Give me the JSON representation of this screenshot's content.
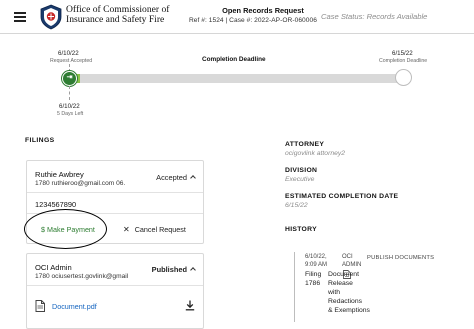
{
  "header": {
    "agency_line1": "Office of Commissioner of",
    "agency_line2": "Insurance and Safety Fire",
    "title": "Open Records Request",
    "ref_line": "Ref #: 1524 | Case #: 2022-AP-OR-060006",
    "case_status": "Case Status: Records Available"
  },
  "timeline": {
    "start_date": "6/10/22",
    "start_label": "Request Accepted",
    "current_date": "6/10/22",
    "current_label": "5 Days Left",
    "deadline_label": "Completion Deadline",
    "end_date": "6/15/22",
    "end_label": "Completion Deadline",
    "progress": 0.02
  },
  "filings": {
    "heading": "FILINGS",
    "card1": {
      "name": "Ruthie Awbrey",
      "sub": "1780   ruthieroo@gmail.com   06.",
      "status": "Accepted",
      "phone": "1234567890",
      "pay_label": "$ Make Payment",
      "cancel_label": "Cancel Request"
    },
    "card2": {
      "name": "OCI Admin",
      "sub": "1780   ociusertest.govlink@gmail",
      "status": "Published",
      "document": "Document.pdf"
    }
  },
  "details": {
    "attorney_label": "ATTORNEY",
    "attorney_value": "ocigovlink attorney2",
    "division_label": "DIVISION",
    "division_value": "Executive",
    "estimated_label": "ESTIMATED COMPLETION DATE",
    "estimated_value": "6/15/22"
  },
  "history": {
    "label": "HISTORY",
    "entry": {
      "date": "6/10/22,",
      "time": "9:09 AM",
      "by_line1": "OCI",
      "by_line2": "ADMIN",
      "action": "PUBLISH DOCUMENTS",
      "filing_line1": "Filing",
      "filing_line2": "1786",
      "desc_line1": "Document",
      "desc_line2": "Release",
      "desc_line3": "with",
      "desc_line4": "Redactions",
      "desc_line5": "& Exemptions"
    }
  },
  "colors": {
    "accent_green": "#2e7d32",
    "link_blue": "#1565c0",
    "muted_text": "#8c8c8c"
  }
}
